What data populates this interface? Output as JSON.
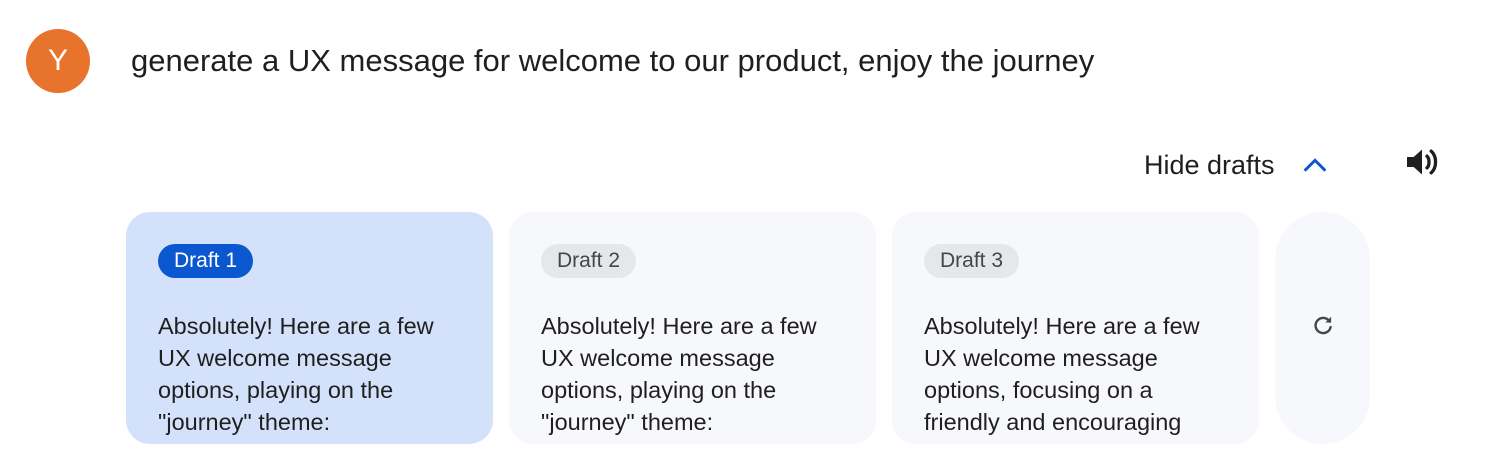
{
  "prompt": {
    "avatar_letter": "Y",
    "avatar_color": "#e8732c",
    "text": "generate a UX message for welcome to our product, enjoy the journey"
  },
  "toolbar": {
    "hide_drafts_label": "Hide drafts",
    "hide_drafts_icon": "chevron-up-icon",
    "speaker_icon": "volume-icon",
    "accent_color": "#0b57d0"
  },
  "drafts": [
    {
      "label": "Draft 1",
      "selected": true,
      "text": "Absolutely! Here are a few\nUX welcome message\noptions, playing on the\n\"journey\" theme:"
    },
    {
      "label": "Draft 2",
      "selected": false,
      "text": "Absolutely! Here are a few\nUX welcome message\noptions, playing on the\n\"journey\" theme:"
    },
    {
      "label": "Draft 3",
      "selected": false,
      "text": "Absolutely! Here are a few\nUX welcome message\noptions, focusing on a\nfriendly and encouraging"
    }
  ],
  "regenerate": {
    "icon": "refresh-icon"
  }
}
